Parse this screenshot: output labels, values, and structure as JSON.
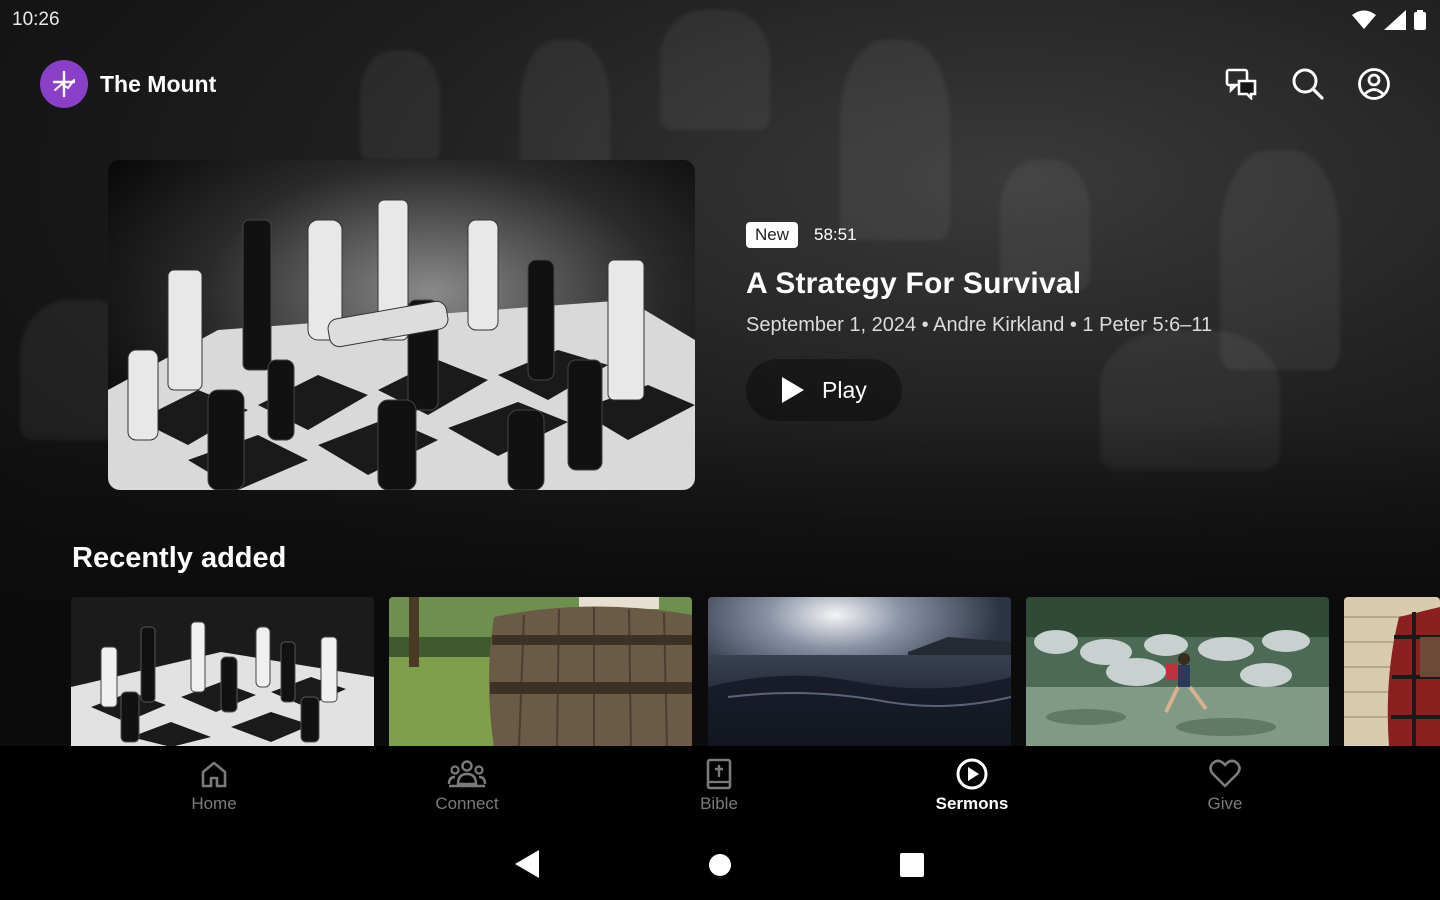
{
  "status_bar": {
    "time": "10:26"
  },
  "app": {
    "name": "The Mount"
  },
  "header_actions": [
    {
      "name": "chat-icon"
    },
    {
      "name": "search-icon"
    },
    {
      "name": "account-icon"
    }
  ],
  "hero": {
    "badge": "New",
    "duration": "58:51",
    "title": "A Strategy For Survival",
    "meta": "September 1, 2024 • Andre Kirkland • 1 Peter 5:6–11",
    "play_label": "Play"
  },
  "recently_added": {
    "title": "Recently added",
    "items": [
      {
        "image": "chessboard"
      },
      {
        "image": "wooden-barrel"
      },
      {
        "image": "ocean-wave"
      },
      {
        "image": "river-rocks"
      },
      {
        "image": "person-plaid"
      }
    ]
  },
  "bottom_nav": {
    "items": [
      {
        "label": "Home",
        "icon": "home-icon"
      },
      {
        "label": "Connect",
        "icon": "people-icon"
      },
      {
        "label": "Bible",
        "icon": "bible-icon"
      },
      {
        "label": "Sermons",
        "icon": "play-circle-icon",
        "active": true
      },
      {
        "label": "Give",
        "icon": "heart-icon"
      }
    ]
  },
  "colors": {
    "brand": "#8a3fc9",
    "background": "#0b0b0b",
    "nav_inactive": "#7b7b7b"
  }
}
